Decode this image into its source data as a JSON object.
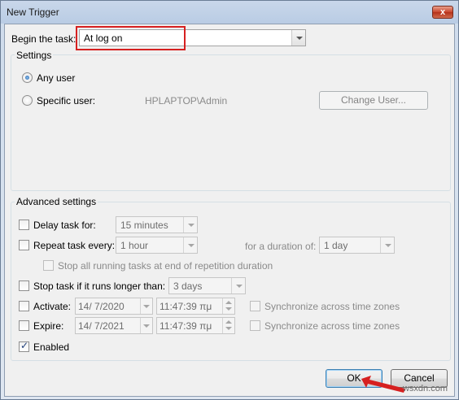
{
  "window": {
    "title": "New Trigger",
    "close_glyph": "x"
  },
  "begin_task": {
    "label": "Begin the task:",
    "value": "At log on"
  },
  "settings": {
    "title": "Settings",
    "any_user_label": "Any user",
    "specific_user_label": "Specific user:",
    "user_value": "HPLAPTOP\\Admin",
    "change_user_label": "Change User..."
  },
  "advanced": {
    "title": "Advanced settings",
    "delay_label": "Delay task for:",
    "delay_value": "15 minutes",
    "repeat_label": "Repeat task every:",
    "repeat_value": "1 hour",
    "duration_label": "for a duration of:",
    "duration_value": "1 day",
    "stop_running_label": "Stop all running tasks at end of repetition duration",
    "stop_longer_label": "Stop task if it runs longer than:",
    "stop_longer_value": "3 days",
    "activate_label": "Activate:",
    "activate_date": "14/ 7/2020",
    "activate_time": "11:47:39 πμ",
    "expire_label": "Expire:",
    "expire_date": "14/ 7/2021",
    "expire_time": "11:47:39 πμ",
    "sync_label": "Synchronize across time zones",
    "enabled_label": "Enabled"
  },
  "buttons": {
    "ok_label": "OK",
    "cancel_label": "Cancel"
  },
  "watermark": "wsxdn.com",
  "colors": {
    "highlight": "#d62020",
    "accent": "#1e5fa8"
  }
}
